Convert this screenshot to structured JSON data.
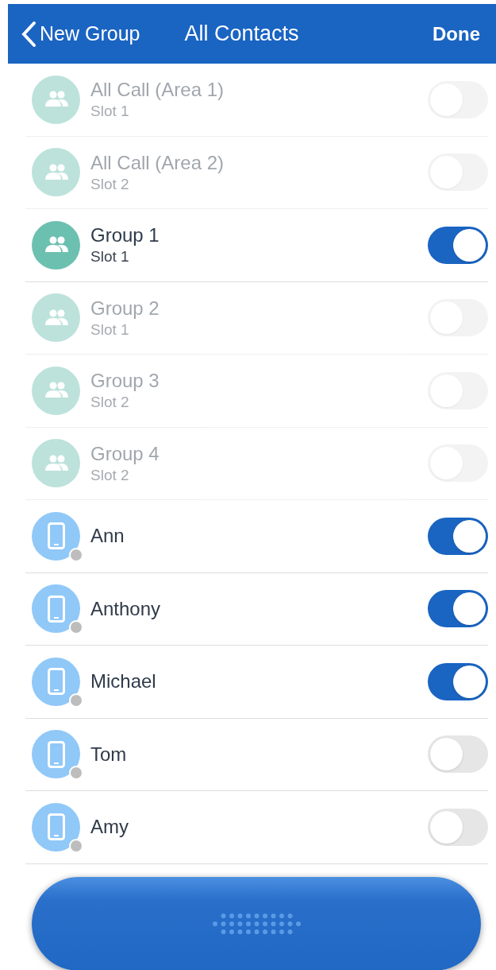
{
  "nav_bar": {
    "back_label": "New Group",
    "title": "All Contacts",
    "done_label": "Done"
  },
  "rows": [
    {
      "kind": "group",
      "name": "All Call (Area 1)",
      "subtitle": "Slot 1",
      "on": false,
      "disabled": true
    },
    {
      "kind": "group",
      "name": "All Call (Area 2)",
      "subtitle": "Slot 2",
      "on": false,
      "disabled": true
    },
    {
      "kind": "group",
      "name": "Group 1",
      "subtitle": "Slot 1",
      "on": true,
      "disabled": false
    },
    {
      "kind": "group",
      "name": "Group 2",
      "subtitle": "Slot 1",
      "on": false,
      "disabled": true
    },
    {
      "kind": "group",
      "name": "Group 3",
      "subtitle": "Slot 2",
      "on": false,
      "disabled": true
    },
    {
      "kind": "group",
      "name": "Group 4",
      "subtitle": "Slot 2",
      "on": false,
      "disabled": true
    },
    {
      "kind": "contact",
      "name": "Ann",
      "on": true,
      "disabled": false
    },
    {
      "kind": "contact",
      "name": "Anthony",
      "on": true,
      "disabled": false
    },
    {
      "kind": "contact",
      "name": "Michael",
      "on": true,
      "disabled": false
    },
    {
      "kind": "contact",
      "name": "Tom",
      "on": false,
      "disabled": false
    },
    {
      "kind": "contact",
      "name": "Amy",
      "on": false,
      "disabled": false
    }
  ]
}
